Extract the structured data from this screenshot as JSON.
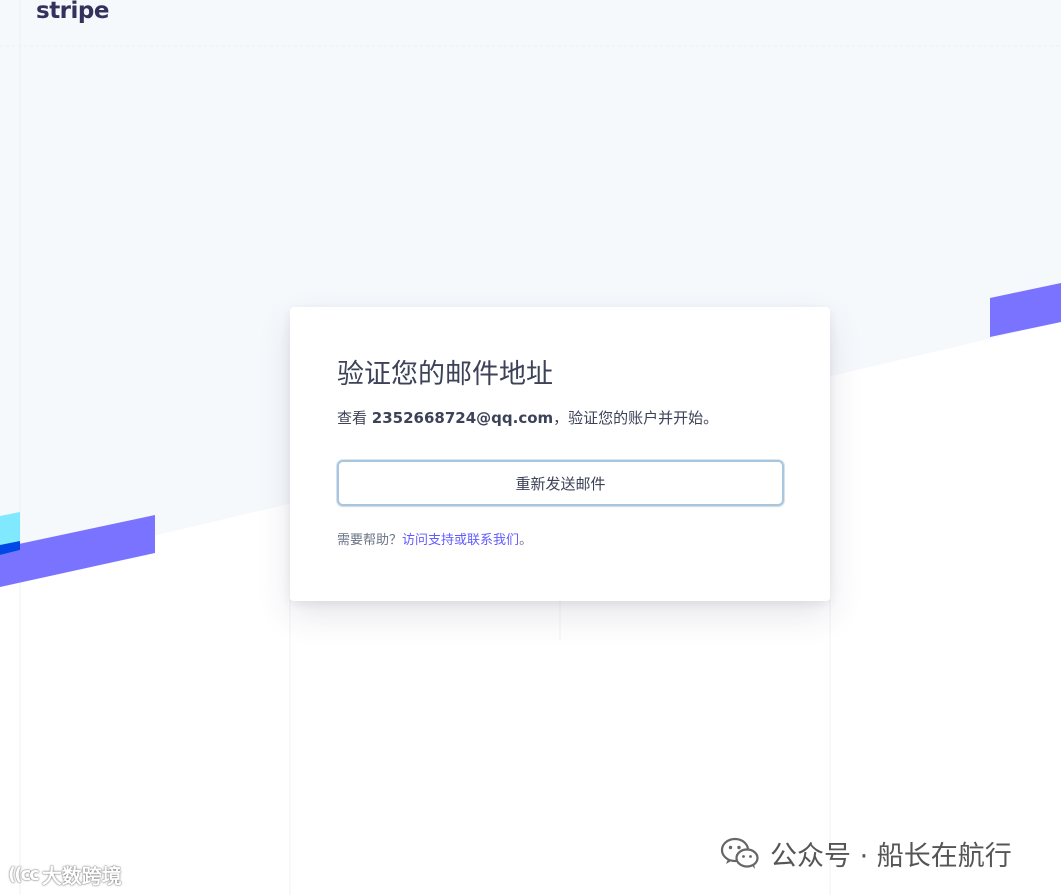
{
  "brand": {
    "logo_text": "stripe"
  },
  "card": {
    "title": "验证您的邮件地址",
    "desc_prefix": "查看 ",
    "email": "2352668724@qq.com",
    "desc_suffix": "，验证您的账户并开始。",
    "resend_button_label": "重新发送邮件",
    "help_prefix": "需要帮助？",
    "help_link_support": "访问支持",
    "help_or": "或",
    "help_link_contact": "联系我们",
    "help_suffix": "。"
  },
  "watermarks": {
    "left_logo": "((cc",
    "left_text": "大数跨境",
    "right_text": "公众号 · 船长在航行",
    "right_icon": "wechat-icon"
  },
  "colors": {
    "accent": "#635bff",
    "stripe_band": "#7a73ff",
    "cyan": "#80e9ff",
    "page_bg": "#f6f9fc",
    "text": "#3c4257"
  }
}
